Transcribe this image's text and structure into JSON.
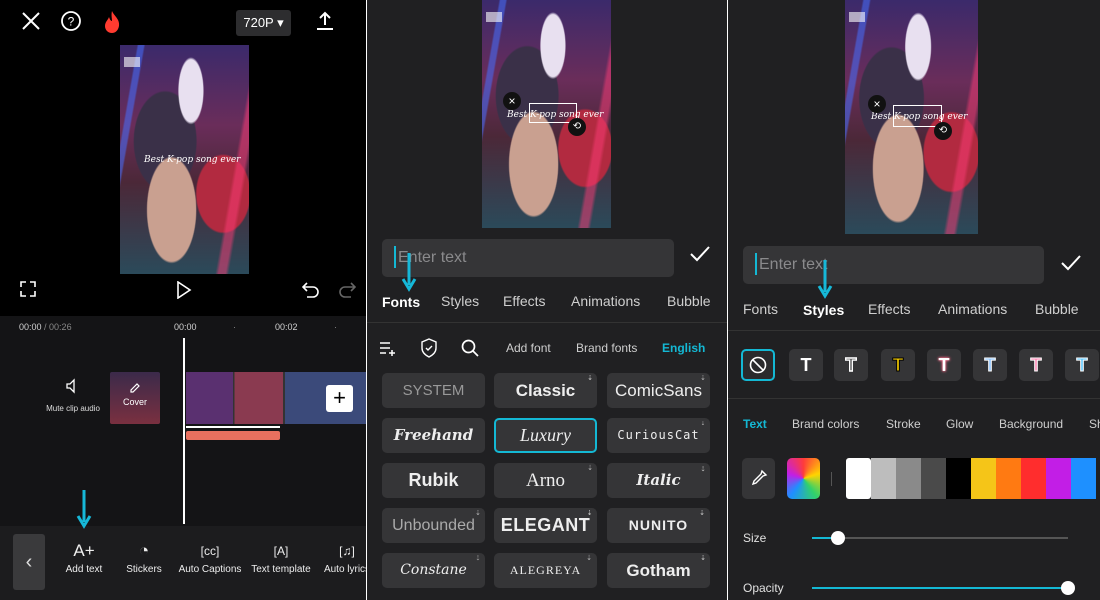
{
  "editor": {
    "resolution": "720P",
    "caption_text": "Best K-pop song ever",
    "time_current": "00:00",
    "time_total": "/ 00:26",
    "ruler_0": "00:00",
    "ruler_2": "00:02",
    "mute_label": "Mute clip audio",
    "cover_label": "Cover",
    "toolbar": [
      {
        "label": "Add text",
        "glyph": "A+"
      },
      {
        "label": "Stickers",
        "glyph": "◔"
      },
      {
        "label": "Auto Captions",
        "glyph": "[cc]"
      },
      {
        "label": "Text template",
        "glyph": "[A]"
      },
      {
        "label": "Auto lyrics",
        "glyph": "[♫]"
      }
    ]
  },
  "fonts_panel": {
    "placeholder": "Enter text",
    "tabs": [
      "Fonts",
      "Styles",
      "Effects",
      "Animations",
      "Bubble"
    ],
    "sub_tabs": [
      "Add font",
      "Brand fonts",
      "English"
    ],
    "fonts": [
      "SYSTEM",
      "Classic",
      "ComicSans",
      "Freehand",
      "Luxury",
      "CuriousCat",
      "Rubik",
      "Arno",
      "Italic",
      "Unbounded",
      "ELEGANT",
      "NUNITO",
      "Constane",
      "ALEGREYA",
      "Gotham"
    ],
    "selected_font": "Luxury"
  },
  "styles_panel": {
    "placeholder": "Enter text",
    "tabs": [
      "Fonts",
      "Styles",
      "Effects",
      "Animations",
      "Bubble"
    ],
    "style_glyph": "T",
    "sub_tabs": [
      "Text",
      "Brand colors",
      "Stroke",
      "Glow",
      "Background",
      "Sh"
    ],
    "size_label": "Size",
    "opacity_label": "Opacity",
    "size_value_pct": 10,
    "opacity_value_pct": 100,
    "swatch_colors": [
      "#ffffff",
      "#bdbdbd",
      "#8a8a8a",
      "#4a4a4a",
      "#000000",
      "#f5c518",
      "#ff7a12",
      "#ff2d2d",
      "#c21ee6",
      "#1e90ff"
    ],
    "style_colors": [
      "#ffffff",
      "#ffffff",
      "#ffd400",
      "#ff6b8a",
      "#8ec5ff",
      "#ff8ab8",
      "#5ec8ff"
    ]
  },
  "colors": {
    "accent": "#14b8d4",
    "brand_flame": "#ff3b30",
    "clip": "#e8705f"
  }
}
